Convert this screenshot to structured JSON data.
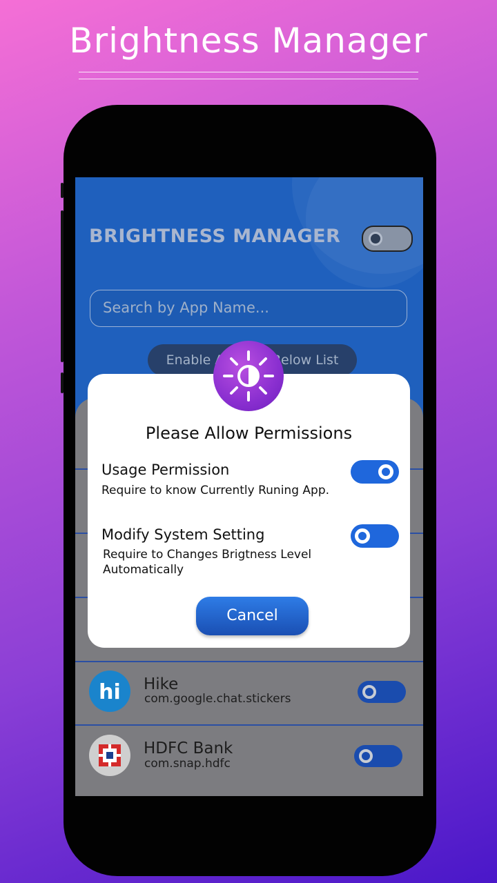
{
  "banner": {
    "headline": "Brightness Manager"
  },
  "app": {
    "title": "BRIGHTNESS MANAGER",
    "master_toggle": "off",
    "search": {
      "placeholder": "Search by App Name..."
    },
    "enable_all_label": "Enable All Apps Below List"
  },
  "app_list": [
    {
      "name": "Hike",
      "package": "com.google.chat.stickers",
      "icon": "hike-icon",
      "enabled": false
    },
    {
      "name": "HDFC Bank",
      "package": "com.snap.hdfc",
      "icon": "hdfc-bank-icon",
      "enabled": false
    }
  ],
  "dialog": {
    "icon": "brightness-sun-icon",
    "title": "Please Allow Permissions",
    "permissions": [
      {
        "name": "Usage Permission",
        "description": "Require to know Currently Runing App.",
        "granted": true
      },
      {
        "name": "Modify System Setting",
        "description_line1": "Require to Changes Brigtness Level",
        "description_line2": "Automatically",
        "granted": false
      }
    ],
    "cancel_label": "Cancel"
  },
  "colors": {
    "accent": "#1f67dc",
    "dialog_icon": "#8a2fd0"
  }
}
